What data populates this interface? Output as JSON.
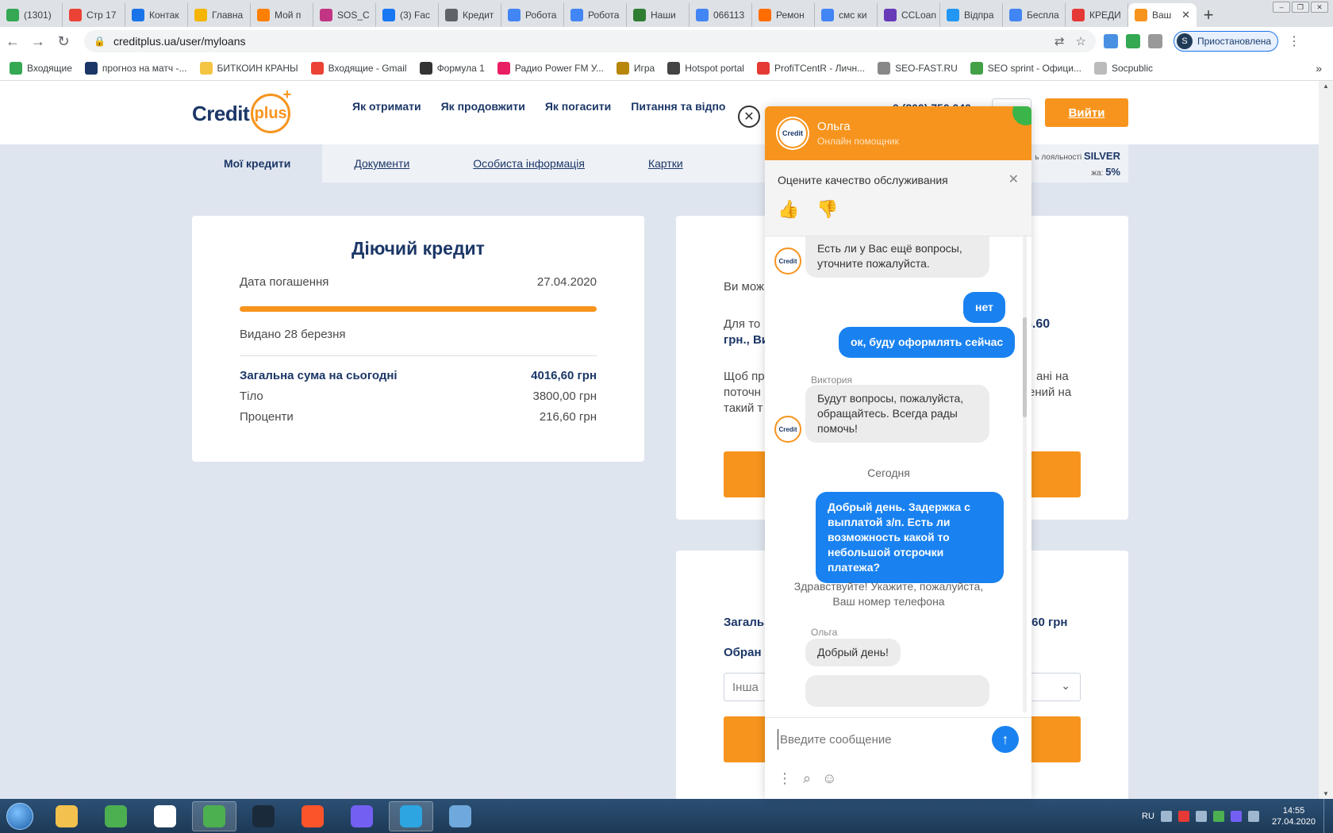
{
  "browser": {
    "tabs": [
      {
        "label": "(1301)",
        "color": "#34a853"
      },
      {
        "label": "Стр 17",
        "color": "#ea4335"
      },
      {
        "label": "Контак",
        "color": "#1a73e8"
      },
      {
        "label": "Главна",
        "color": "#f4b400"
      },
      {
        "label": "Мой п",
        "color": "#ff7f00"
      },
      {
        "label": "SOS_C",
        "color": "#c13584"
      },
      {
        "label": "(3) Fac",
        "color": "#1877f2"
      },
      {
        "label": "Кредит",
        "color": "#5f6368"
      },
      {
        "label": "Робота",
        "color": "#4285f4"
      },
      {
        "label": "Робота",
        "color": "#4285f4"
      },
      {
        "label": "Наши",
        "color": "#2e7d32"
      },
      {
        "label": "066113",
        "color": "#4285f4"
      },
      {
        "label": "Ремон",
        "color": "#ff6d00"
      },
      {
        "label": "смс ки",
        "color": "#4285f4"
      },
      {
        "label": "CCLoan",
        "color": "#673ab7"
      },
      {
        "label": "Відпра",
        "color": "#2196f3"
      },
      {
        "label": "Беспла",
        "color": "#4285f4"
      },
      {
        "label": "КРЕДИ",
        "color": "#e53935"
      }
    ],
    "active_tab": {
      "label": "Ваш",
      "color": "#f7941d"
    },
    "url": "creditplus.ua/user/myloans",
    "profile_initial": "S",
    "profile_status": "Приостановлена",
    "bookmarks": [
      {
        "label": "Входящие",
        "color": "#34a853"
      },
      {
        "label": "прогноз на матч -...",
        "color": "#1c3767"
      },
      {
        "label": "БИТКОИН КРАНЫ",
        "color": "#f4c542"
      },
      {
        "label": "Входящие - Gmail",
        "color": "#ea4335"
      },
      {
        "label": "Формула 1",
        "color": "#333333"
      },
      {
        "label": "Радио Power FM У...",
        "color": "#e91e63"
      },
      {
        "label": "Игра",
        "color": "#b8860b"
      },
      {
        "label": "Hotspot portal",
        "color": "#444444"
      },
      {
        "label": "ProfiTCentR - Личн...",
        "color": "#e53935"
      },
      {
        "label": "SEO-FAST.RU",
        "color": "#888888"
      },
      {
        "label": "SEO sprint - Офици...",
        "color": "#43a047"
      },
      {
        "label": "Socpublic",
        "color": "#bbbbbb"
      }
    ]
  },
  "site": {
    "logo_word": "Credit",
    "logo_ring": "plus",
    "nav": [
      "Як отримати",
      "Як продовжити",
      "Як погасити",
      "Питання та відпо"
    ],
    "phone": "0 (800) 750 040",
    "logout": "Вийти",
    "subnav": [
      "Мої кредити",
      "Документи",
      "Особиста інформація",
      "Картки"
    ],
    "loyalty_label": "ь лояльності",
    "loyalty_level": "SILVER",
    "discount_label": "жа:",
    "discount_value": "5%"
  },
  "credit": {
    "title": "Діючий кредит",
    "due_label": "Дата погашення",
    "due_date": "27.04.2020",
    "progress_fraction": 1.0,
    "issued": "Видано 28 березня",
    "total_label": "Загальна сума на сьогодні",
    "total_value": "4016,60 грн",
    "body_label": "Тіло",
    "body_value": "3800,00 грн",
    "interest_label": "Проценти",
    "interest_value": "216,60 грн"
  },
  "right_card": {
    "line1": "Ви мож",
    "line2a": "Для то",
    "line2b": "6.60",
    "line3": "грн., Ви",
    "line4a": "Щоб пр",
    "line4b": "ані на",
    "line5a": "поточн",
    "line5b": "ений на",
    "line6": "такий т"
  },
  "pay_card": {
    "total_label": "Загаль",
    "total_value": ",60 грн",
    "choose_label": "Обран",
    "select_value": "Інша"
  },
  "chat": {
    "agent_name": "Ольга",
    "agent_role": "Онлайн помощник",
    "badge": "Credit",
    "rate_question": "Оцените качество обслуживания",
    "messages": {
      "m1": "Есть ли у Вас ещё вопросы, уточните пожалуйста.",
      "m2": "нет",
      "m3": "ок, буду оформлять сейчас",
      "sender1": "Виктория",
      "m4": "Будут вопросы, пожалуйста, обращайтесь. Всегда рады помочь!",
      "day": "Сегодня",
      "m5": "Добрый день. Задержка с выплатой з/п. Есть ли возможность какой то небольшой отсрочки платежа?",
      "m6": "Здравствуйте! Укажите, пожалуйста, Ваш номер телефона",
      "sender2": "Ольга",
      "m7": "Добрый день!"
    },
    "input_placeholder": "Введите сообщение"
  },
  "taskbar": {
    "apps": [
      {
        "name": "explorer",
        "color": "#f2c14e"
      },
      {
        "name": "icq",
        "color": "#4caf50"
      },
      {
        "name": "yandex",
        "color": "#ffffff"
      },
      {
        "name": "chrome",
        "color": "#4caf50"
      },
      {
        "name": "nox",
        "color": "#1b2a3a"
      },
      {
        "name": "brave",
        "color": "#fb542b"
      },
      {
        "name": "viber",
        "color": "#7360f2"
      },
      {
        "name": "telegram",
        "color": "#2ca5e0"
      },
      {
        "name": "notepad",
        "color": "#6fa8dc"
      }
    ],
    "lang": "RU",
    "time": "14:55",
    "date": "27.04.2020"
  }
}
